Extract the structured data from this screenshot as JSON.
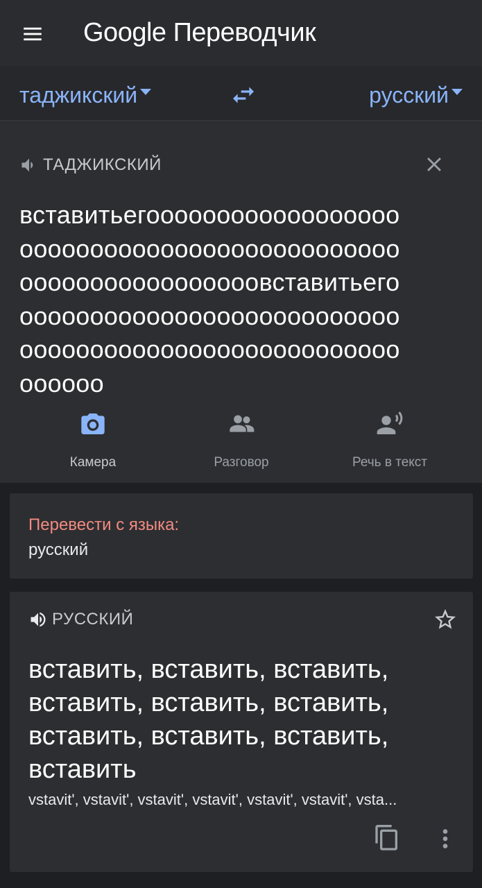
{
  "header": {
    "app_title": "Google Переводчик",
    "menu_icon": "hamburger-menu-icon"
  },
  "language_bar": {
    "source_language": "таджикский",
    "target_language": "русский",
    "swap_icon": "swap-arrows-icon"
  },
  "input": {
    "language_label": "ТАДЖИКСКИЙ",
    "text": "вставитьегооооооооооооооооооооооооооооооооооооооооооооооооооооооооооооооооооооооооооооооооооооооооооооооооооооооооооооооооооооооооооооооооооооо",
    "display_lines": [
      "вставитьегоооооооооооооооооо",
      "ооооооооооооооооооооооооооо",
      "ооооооооооооооооовставитьего",
      "ооооооооооооооооооооооооооо",
      "ооооооооооооооооооооооооооо",
      "оооооо"
    ]
  },
  "tools": [
    {
      "label": "Камера",
      "icon": "camera-icon",
      "active": true
    },
    {
      "label": "Разговор",
      "icon": "conversation-icon",
      "active": false
    },
    {
      "label": "Речь в текст",
      "icon": "transcribe-icon",
      "active": false
    }
  ],
  "detect_card": {
    "title": "Перевести с языка:",
    "value": "русский"
  },
  "result": {
    "language_label": "РУССКИЙ",
    "text_lines": [
      "вставить, вставить, вставить,",
      "вставить, вставить, вставить,",
      "вставить, вставить, вставить,",
      "вставить"
    ],
    "transliteration": "vstavit', vstavit', vstavit', vstavit', vstavit', vstavit', vsta..."
  },
  "colors": {
    "accent": "#8ab4f8",
    "detect_title": "#f28b82",
    "panel_bg": "#2d2e31",
    "page_bg": "#1e1f22"
  }
}
